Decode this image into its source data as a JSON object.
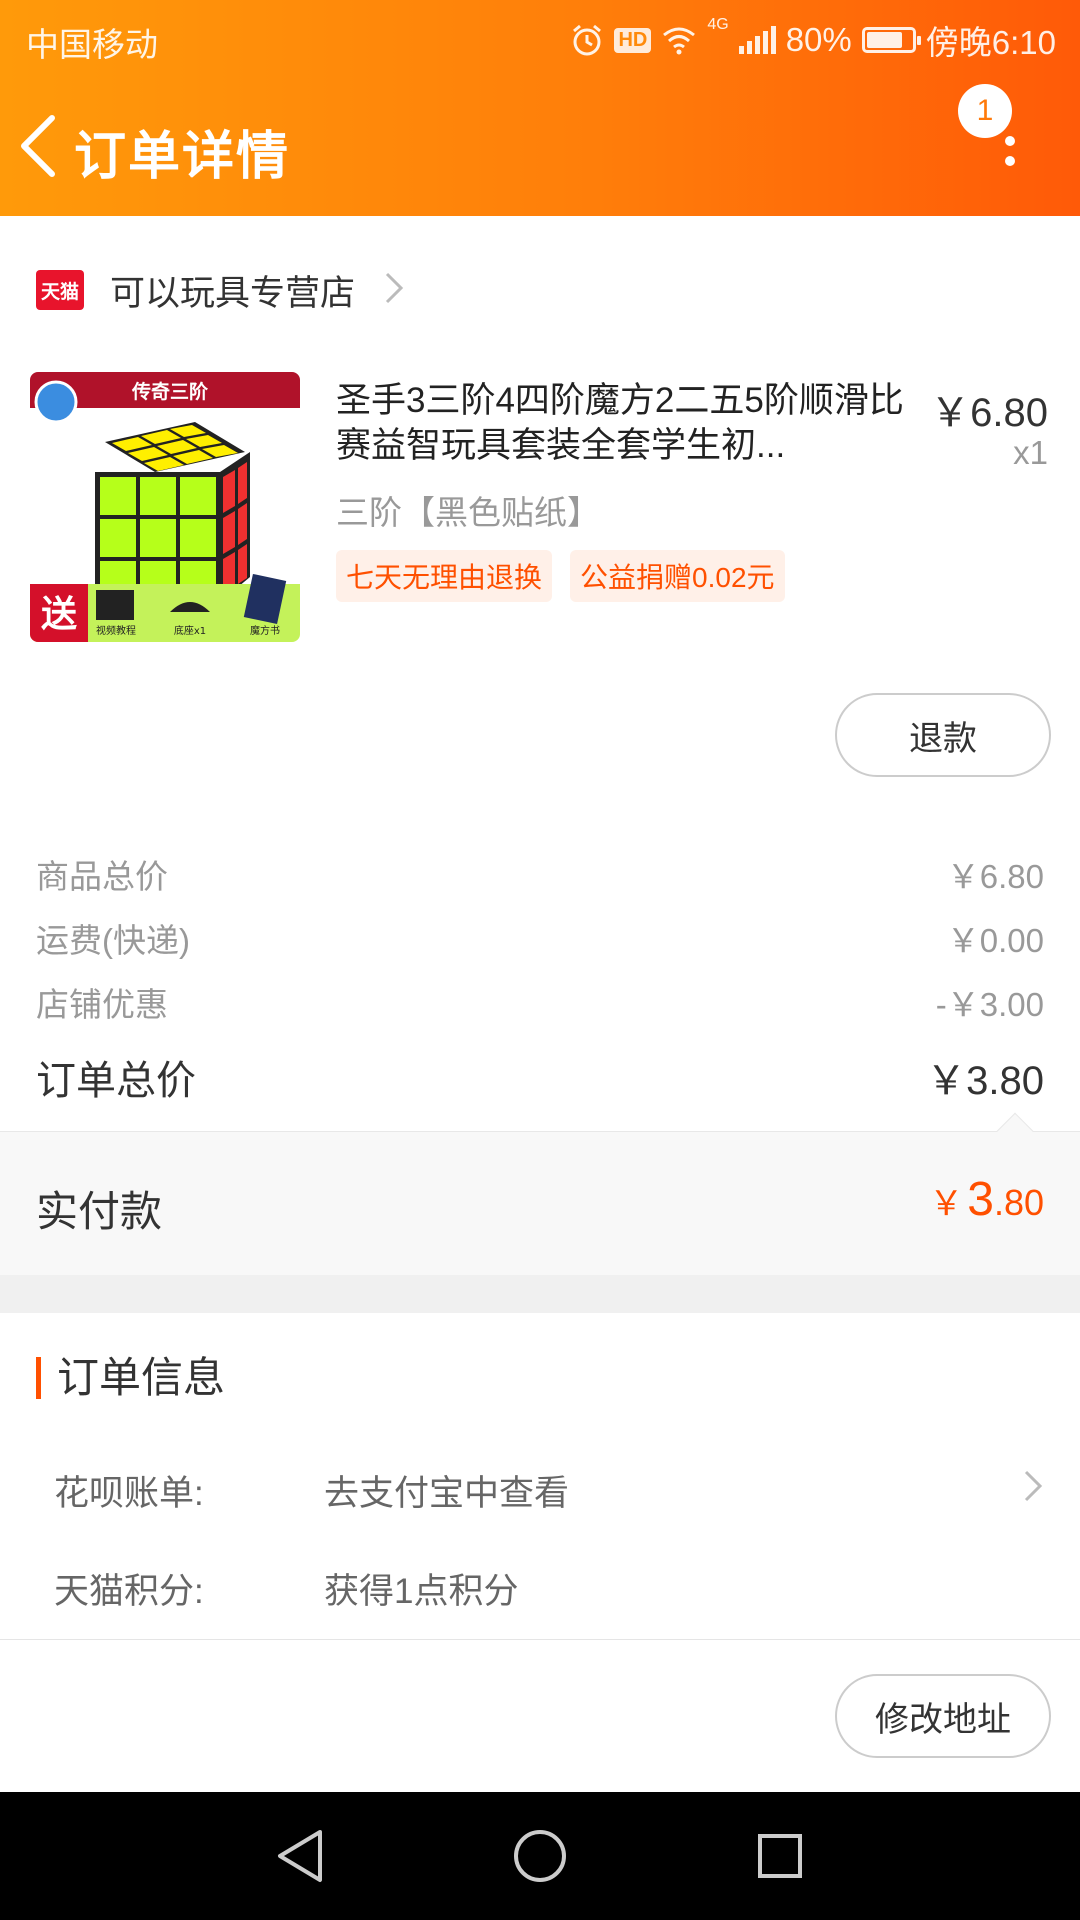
{
  "status": {
    "carrier": "中国移动",
    "hd": "HD",
    "net": "4G",
    "battery": "80%",
    "battery_level": 0.8,
    "time": "傍晚6:10"
  },
  "header": {
    "title": "订单详情",
    "badge": "1"
  },
  "store": {
    "logo": "天猫",
    "name": "可以玩具专营店"
  },
  "product": {
    "image_banner": "传奇三阶",
    "image_gift": "送",
    "image_gift_items": [
      "视频教程",
      "底座x1",
      "魔方书"
    ],
    "title": "圣手3三阶4四阶魔方2二五5阶顺滑比赛益智玩具套装全套学生初...",
    "price": "￥6.80",
    "qty": "x1",
    "sku": "三阶【黑色贴纸】",
    "tags": [
      "七天无理由退换",
      "公益捐赠0.02元"
    ],
    "refund_label": "退款"
  },
  "prices": {
    "goods_label": "商品总价",
    "goods_value": "￥6.80",
    "shipping_label": "运费(快递)",
    "shipping_value": "￥0.00",
    "discount_label": "店铺优惠",
    "discount_value": "-￥3.00",
    "total_label": "订单总价",
    "total_value": "￥3.80"
  },
  "paid": {
    "label": "实付款",
    "symbol": "￥",
    "integer": "3",
    "decimal": ".80"
  },
  "info": {
    "title": "订单信息",
    "huabei_label": "花呗账单:",
    "huabei_value": "去支付宝中查看",
    "points_label": "天猫积分:",
    "points_value": "获得1点积分"
  },
  "actions": {
    "modify_address": "修改地址"
  },
  "colors": {
    "accent": "#ff5000",
    "header_start": "#ff9a0a",
    "header_end": "#ff5a08"
  }
}
